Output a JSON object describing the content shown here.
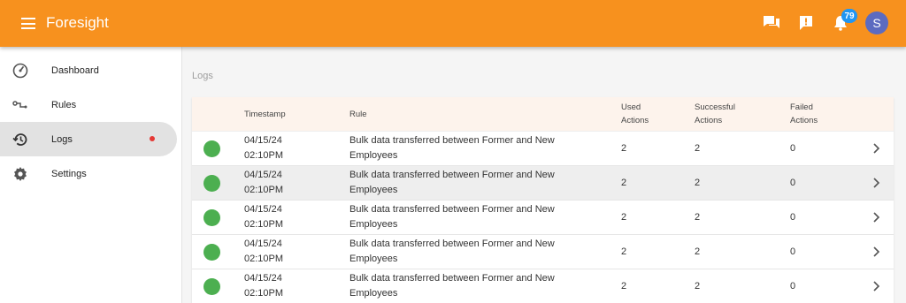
{
  "app": {
    "title": "Foresight"
  },
  "topbar": {
    "icons": [
      "chat-icon",
      "feedback-icon",
      "notification-bell-icon"
    ],
    "notification_count": "79",
    "avatar_letter": "S",
    "accent": "#f7911e"
  },
  "sidebar": {
    "items": [
      {
        "label": "Dashboard",
        "icon": "speedometer-icon"
      },
      {
        "label": "Rules",
        "icon": "rules-icon"
      },
      {
        "label": "Logs",
        "icon": "history-icon"
      },
      {
        "label": "Settings",
        "icon": "gear-icon"
      }
    ]
  },
  "page": {
    "section_title": "Logs"
  },
  "table": {
    "headers": {
      "timestamp": "Timestamp",
      "rule": "Rule",
      "used_1": "Used",
      "used_2": "Actions",
      "successful_1": "Successful",
      "successful_2": "Actions",
      "failed_1": "Failed",
      "failed_2": "Actions"
    },
    "rows": [
      {
        "date": "04/15/24",
        "time": "02:10PM",
        "rule_1": "Bulk data transferred between Former and New",
        "rule_2": "Employees",
        "used": "2",
        "successful": "2",
        "failed": "0",
        "status": "success"
      },
      {
        "date": "04/15/24",
        "time": "02:10PM",
        "rule_1": "Bulk data transferred between Former and New",
        "rule_2": "Employees",
        "used": "2",
        "successful": "2",
        "failed": "0",
        "status": "success"
      },
      {
        "date": "04/15/24",
        "time": "02:10PM",
        "rule_1": "Bulk data transferred between Former and New",
        "rule_2": "Employees",
        "used": "2",
        "successful": "2",
        "failed": "0",
        "status": "success"
      },
      {
        "date": "04/15/24",
        "time": "02:10PM",
        "rule_1": "Bulk data transferred between Former and New",
        "rule_2": "Employees",
        "used": "2",
        "successful": "2",
        "failed": "0",
        "status": "success"
      },
      {
        "date": "04/15/24",
        "time": "02:10PM",
        "rule_1": "Bulk data transferred between Former and New",
        "rule_2": "Employees",
        "used": "2",
        "successful": "2",
        "failed": "0",
        "status": "success"
      }
    ]
  }
}
